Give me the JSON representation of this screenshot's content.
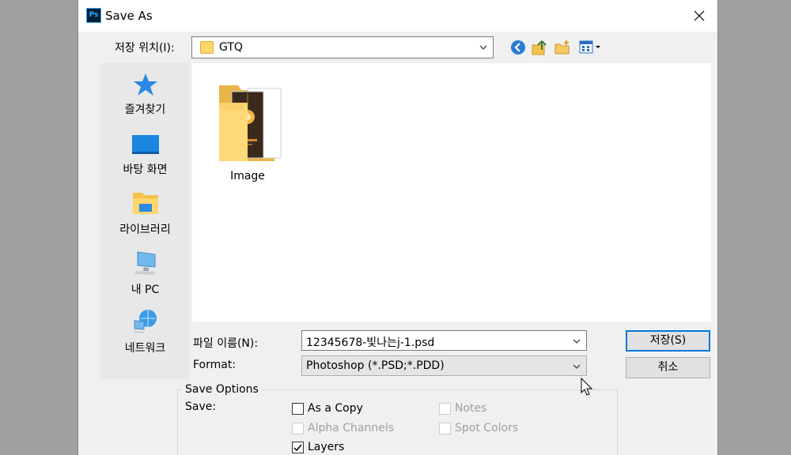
{
  "window": {
    "title": "Save As",
    "app_icon_text": "Ps"
  },
  "location": {
    "label": "저장 위치(I):",
    "value": "GTQ"
  },
  "places": [
    {
      "label": "즐겨찾기",
      "icon": "star-icon"
    },
    {
      "label": "바탕 화면",
      "icon": "desktop-icon"
    },
    {
      "label": "라이브러리",
      "icon": "library-icon"
    },
    {
      "label": "내 PC",
      "icon": "computer-icon"
    },
    {
      "label": "네트워크",
      "icon": "network-icon"
    }
  ],
  "files": [
    {
      "name": "Image",
      "type": "folder"
    }
  ],
  "filename": {
    "label": "파일 이름(N):",
    "value": "12345678-빛나는j-1.psd"
  },
  "format": {
    "label": "Format:",
    "value": "Photoshop (*.PSD;*.PDD)"
  },
  "buttons": {
    "save": "저장(S)",
    "cancel": "취소"
  },
  "save_options": {
    "title": "Save Options",
    "save_label": "Save:",
    "options": [
      {
        "label": "As a Copy",
        "checked": false,
        "enabled": true
      },
      {
        "label": "Notes",
        "checked": false,
        "enabled": false
      },
      {
        "label": "Alpha Channels",
        "checked": false,
        "enabled": false
      },
      {
        "label": "Spot Colors",
        "checked": false,
        "enabled": false
      },
      {
        "label": "Layers",
        "checked": true,
        "enabled": true
      }
    ]
  },
  "colors": {
    "accent": "#0078d7",
    "dialog_bg": "#f0f0f0",
    "backdrop": "#a0a0a0"
  }
}
